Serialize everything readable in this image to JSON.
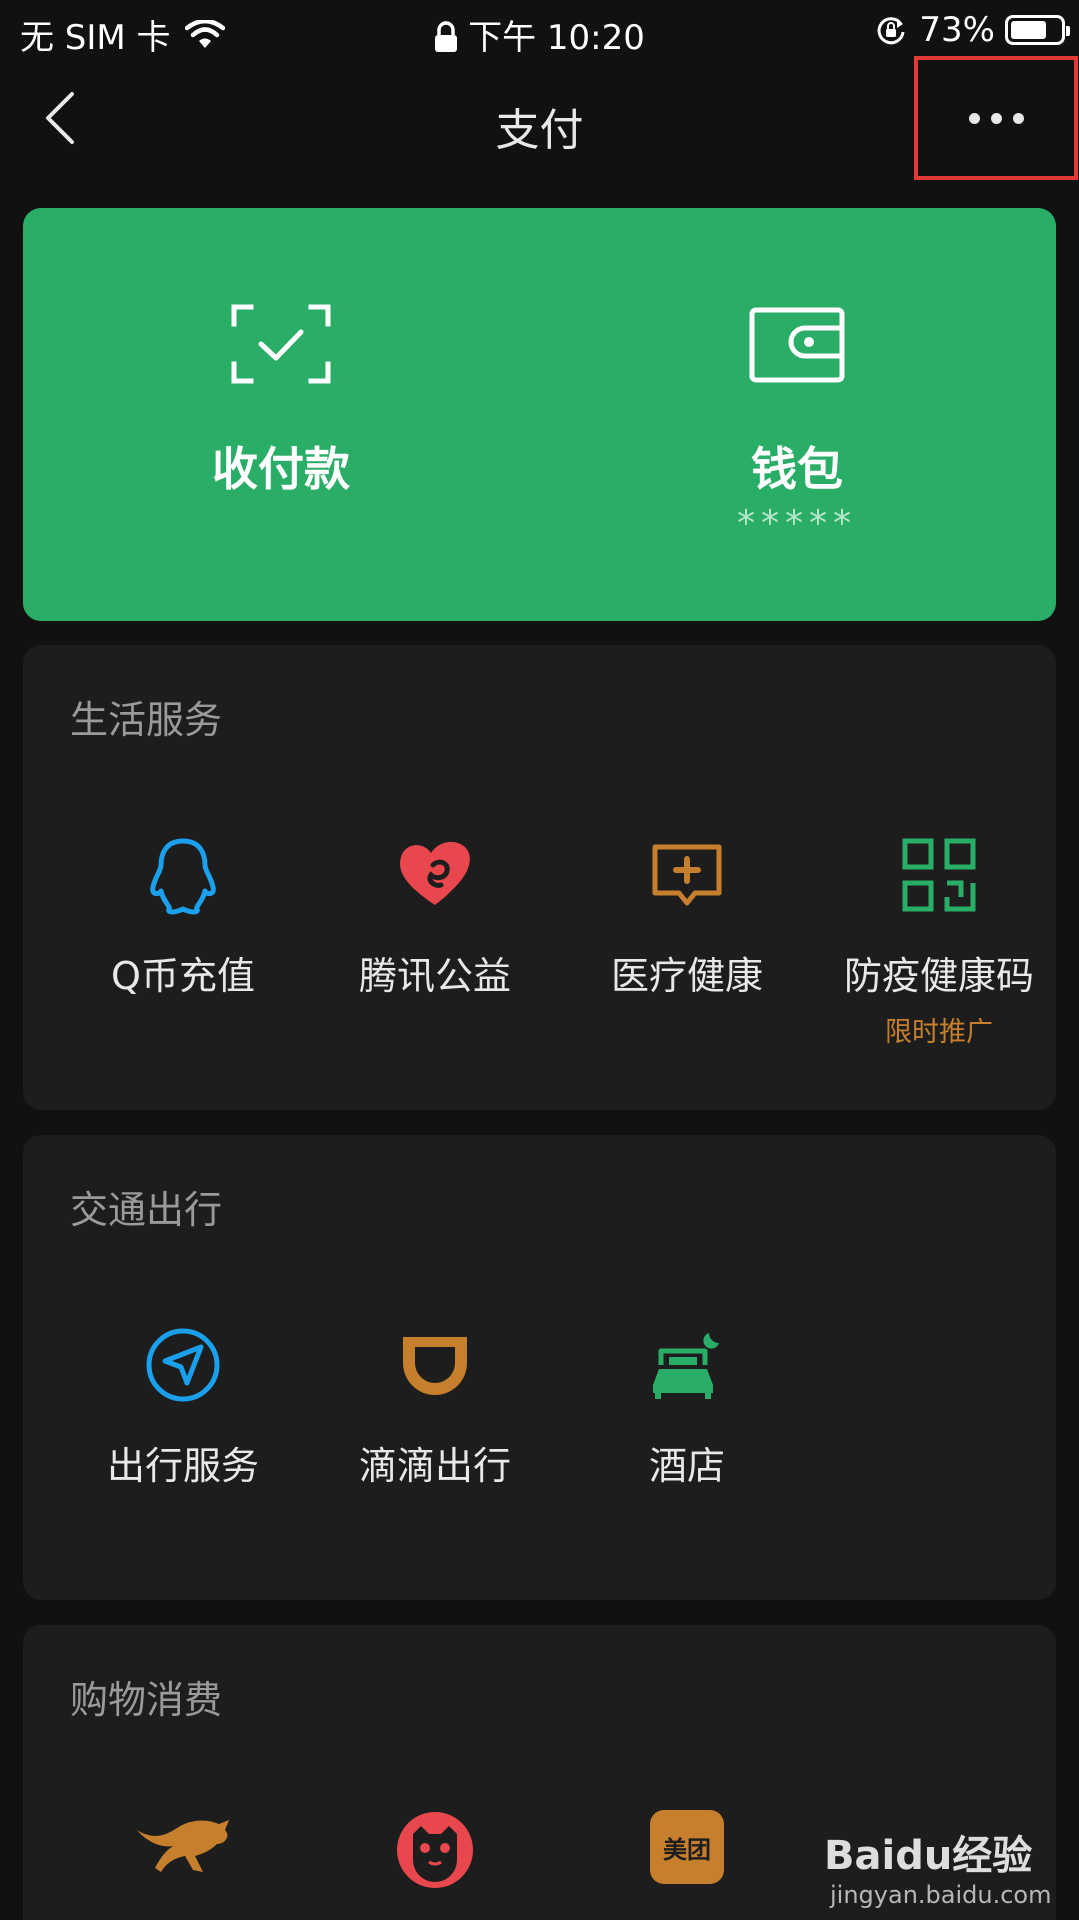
{
  "status_bar": {
    "carrier": "无 SIM 卡",
    "time": "下午 10:20",
    "battery": "73%"
  },
  "nav": {
    "title": "支付"
  },
  "pay_card": {
    "receive_label": "收付款",
    "wallet_label": "钱包",
    "wallet_balance": "*****"
  },
  "sections": [
    {
      "title": "生活服务",
      "items": [
        {
          "label": "Q币充值",
          "icon": "qq-penguin-icon",
          "color": "#1aa0ec"
        },
        {
          "label": "腾讯公益",
          "icon": "charity-heart-icon",
          "color": "#e8484d"
        },
        {
          "label": "医疗健康",
          "icon": "medical-chat-icon",
          "color": "#c57f2d"
        },
        {
          "label": "防疫健康码",
          "sub": "限时推广",
          "icon": "qr-code-icon",
          "color": "#2aae67"
        }
      ]
    },
    {
      "title": "交通出行",
      "items": [
        {
          "label": "出行服务",
          "icon": "navigation-compass-icon",
          "color": "#1aa0ec"
        },
        {
          "label": "滴滴出行",
          "icon": "didi-logo-icon",
          "color": "#c57f2d"
        },
        {
          "label": "酒店",
          "icon": "hotel-bed-icon",
          "color": "#2aae67"
        }
      ]
    },
    {
      "title": "购物消费",
      "items": [
        {
          "label": "",
          "icon": "jd-kangaroo-icon",
          "color": "#c57f2d"
        },
        {
          "label": "",
          "icon": "tmall-cat-icon",
          "color": "#e8484d"
        },
        {
          "label": "美团",
          "icon": "meituan-icon",
          "color": "#c57f2d"
        }
      ]
    }
  ],
  "watermark": {
    "text": "Baidu经验",
    "sub": "jingyan.baidu.com"
  }
}
